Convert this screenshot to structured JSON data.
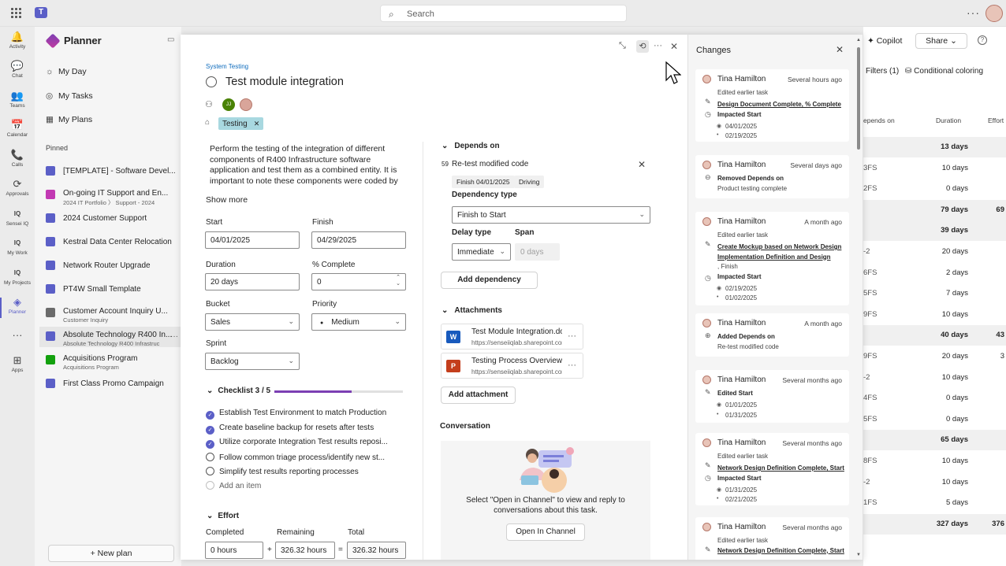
{
  "topbar": {
    "search_placeholder": "Search",
    "more": "···"
  },
  "rail": [
    {
      "icon": "activity-icon",
      "glyph": "🔔",
      "label": "Activity"
    },
    {
      "icon": "chat-icon",
      "glyph": "💬",
      "label": "Chat"
    },
    {
      "icon": "teams-icon",
      "glyph": "👥",
      "label": "Teams"
    },
    {
      "icon": "calendar-icon",
      "glyph": "📅",
      "label": "Calendar"
    },
    {
      "icon": "calls-icon",
      "glyph": "📞",
      "label": "Calls"
    },
    {
      "icon": "approvals-icon",
      "glyph": "⟳",
      "label": "Approvals"
    },
    {
      "icon": "sensei-iq-icon",
      "glyph": "IQ",
      "label": "Sensei IQ"
    },
    {
      "icon": "my-work-icon",
      "glyph": "IQ",
      "label": "My Work"
    },
    {
      "icon": "my-projects-icon",
      "glyph": "IQ",
      "label": "My Projects"
    },
    {
      "icon": "planner-icon",
      "glyph": "◈",
      "label": "Planner"
    },
    {
      "icon": "more-apps-icon",
      "glyph": "···",
      "label": ""
    },
    {
      "icon": "apps-icon",
      "glyph": "⊞",
      "label": "Apps"
    }
  ],
  "leftpane": {
    "title": "Planner",
    "nav": [
      {
        "icon": "sun-icon",
        "glyph": "☼",
        "label": "My Day"
      },
      {
        "icon": "tasks-icon",
        "glyph": "◎",
        "label": "My Tasks"
      },
      {
        "icon": "plans-icon",
        "glyph": "▦",
        "label": "My Plans"
      }
    ],
    "pinned_header": "Pinned",
    "pinned": [
      {
        "name": "[TEMPLATE] - Software Devel...",
        "sub": "",
        "color": "#5b5fc7"
      },
      {
        "name": "On-going IT Support and En...",
        "sub": "2024 IT Portfolio  〉 Support - 2024",
        "color": "#c239b3"
      },
      {
        "name": "2024 Customer Support",
        "sub": "",
        "color": "#5b5fc7"
      },
      {
        "name": "Kestral Data Center Relocation",
        "sub": "",
        "color": "#5b5fc7"
      },
      {
        "name": "Network Router Upgrade",
        "sub": "",
        "color": "#5b5fc7"
      },
      {
        "name": "PT4W Small Template",
        "sub": "",
        "color": "#5b5fc7"
      },
      {
        "name": "Customer Account Inquiry U...",
        "sub": "Customer Inquiry",
        "color": "#6b6b6b"
      },
      {
        "name": "Absolute Technology R400 In...",
        "sub": "Absolute Technology R400 Infrastruc",
        "color": "#5b5fc7"
      },
      {
        "name": "Acquisitions Program",
        "sub": "Acquisitions Program",
        "color": "#13a10e"
      },
      {
        "name": "First Class Promo Campaign",
        "sub": "",
        "color": "#5b5fc7"
      }
    ],
    "new_plan": "New plan"
  },
  "background": {
    "copilot": "Copilot",
    "share": "Share",
    "filters": "Filters (1)",
    "conditional": "Conditional coloring",
    "col_depends": "epends on",
    "col_duration": "Duration",
    "col_effort": "Effort",
    "rows": [
      {
        "a": "",
        "b": "13 days",
        "c": "",
        "bold": true
      },
      {
        "a": "3FS",
        "b": "10 days",
        "c": "",
        "bold": false
      },
      {
        "a": "2FS",
        "b": "0 days",
        "c": "",
        "bold": false
      },
      {
        "a": "",
        "b": "79 days",
        "c": "69",
        "bold": true
      },
      {
        "a": "",
        "b": "39 days",
        "c": "",
        "bold": true
      },
      {
        "a": "-2",
        "b": "20 days",
        "c": "",
        "bold": false
      },
      {
        "a": "6FS",
        "b": "2 days",
        "c": "",
        "bold": false
      },
      {
        "a": "5FS",
        "b": "7 days",
        "c": "",
        "bold": false
      },
      {
        "a": "9FS",
        "b": "10 days",
        "c": "",
        "bold": false
      },
      {
        "a": "",
        "b": "40 days",
        "c": "43",
        "bold": true
      },
      {
        "a": "9FS",
        "b": "20 days",
        "c": "3",
        "bold": false
      },
      {
        "a": "-2",
        "b": "10 days",
        "c": "",
        "bold": false
      },
      {
        "a": "4FS",
        "b": "0 days",
        "c": "",
        "bold": false
      },
      {
        "a": "5FS",
        "b": "0 days",
        "c": "",
        "bold": false
      },
      {
        "a": "",
        "b": "65 days",
        "c": "",
        "bold": true
      },
      {
        "a": "8FS",
        "b": "10 days",
        "c": "",
        "bold": false
      },
      {
        "a": "-2",
        "b": "10 days",
        "c": "",
        "bold": false
      },
      {
        "a": "1FS",
        "b": "5 days",
        "c": "",
        "bold": false
      },
      {
        "a": "",
        "b": "327 days",
        "c": "376",
        "bold": true
      }
    ]
  },
  "task": {
    "breadcrumb": "System Testing",
    "title": "Test module integration",
    "assignees": [
      {
        "initials": "JJ",
        "color": "#498205"
      },
      {
        "initials": "",
        "color": "#d9a59a"
      }
    ],
    "label": "Testing",
    "description": "Perform the testing of the integration of different components of R400 Infrastructure software application and test them as a combined entity. It is important to note these components were coded by different",
    "show_more": "Show more",
    "start_label": "Start",
    "start": "04/01/2025",
    "finish_label": "Finish",
    "finish": "04/29/2025",
    "duration_label": "Duration",
    "duration": "20 days",
    "complete_label": "% Complete",
    "complete": "0",
    "bucket_label": "Bucket",
    "bucket": "Sales",
    "priority_label": "Priority",
    "priority": "Medium",
    "sprint_label": "Sprint",
    "sprint": "Backlog",
    "checklist_label": "Checklist 3 / 5",
    "checklist_progress": 0.6,
    "checklist": [
      {
        "text": "Establish Test Environment to match Production",
        "done": true
      },
      {
        "text": "Create baseline backup for resets after tests",
        "done": true
      },
      {
        "text": "Utilize corporate Integration Test results reposi...",
        "done": true
      },
      {
        "text": "Follow common triage process/identify new st...",
        "done": false
      },
      {
        "text": "Simplify test results reporting processes",
        "done": false
      }
    ],
    "add_item": "Add an item",
    "effort_label": "Effort",
    "completed_label": "Completed",
    "completed": "0 hours",
    "remaining_label": "Remaining",
    "remaining": "326.32 hours",
    "total_label": "Total",
    "total": "326.32 hours",
    "plus": "+",
    "equals": "="
  },
  "depends": {
    "header": "Depends on",
    "item_id": "59",
    "item_name": "Re-test modified code",
    "chip_finish": "Finish 04/01/2025",
    "chip_driving": "Driving",
    "dep_type_label": "Dependency type",
    "dep_type": "Finish to Start",
    "delay_type_label": "Delay type",
    "delay_type": "Immediate",
    "span_label": "Span",
    "span_placeholder": "0 days",
    "add_dependency": "Add dependency"
  },
  "attachments": {
    "header": "Attachments",
    "items": [
      {
        "name": "Test Module Integration.docx",
        "url": "https://senseiiqlab.sharepoint.com",
        "type": "W",
        "color": "#185abd"
      },
      {
        "name": "Testing Process Overview.pptx",
        "url": "https://senseiiqlab.sharepoint.com",
        "type": "P",
        "color": "#c43e1c"
      }
    ],
    "add": "Add attachment"
  },
  "conversation": {
    "header": "Conversation",
    "text": "Select \"Open in Channel\" to view and reply to conversations about this task.",
    "button": "Open In Channel"
  },
  "changes": {
    "title": "Changes",
    "cards": [
      {
        "who": "Tina Hamilton",
        "when": "Several hours ago",
        "lines": [
          {
            "t": "Edited earlier task",
            "s": ""
          },
          {
            "t": "Design Document Complete, % Complete",
            "s": "u"
          },
          {
            "t": "Impacted Start",
            "s": "b"
          },
          {
            "t": "04/01/2025",
            "s": ""
          },
          {
            "t": "02/19/2025",
            "s": ""
          }
        ]
      },
      {
        "who": "Tina Hamilton",
        "when": "Several days ago",
        "lines": [
          {
            "t": "Removed Depends on",
            "s": "b"
          },
          {
            "t": "Product testing complete",
            "s": ""
          }
        ]
      },
      {
        "who": "Tina Hamilton",
        "when": "A month ago",
        "lines": [
          {
            "t": "Edited earlier task",
            "s": ""
          },
          {
            "t": "Create Mockup based on Network Design",
            "s": "u"
          },
          {
            "t": "Implementation Definition and Design",
            "s": "u"
          },
          {
            "t": ", Finish",
            "s": ""
          },
          {
            "t": "Impacted Start",
            "s": "b"
          },
          {
            "t": "02/19/2025",
            "s": ""
          },
          {
            "t": "01/02/2025",
            "s": ""
          }
        ]
      },
      {
        "who": "Tina Hamilton",
        "when": "A month ago",
        "lines": [
          {
            "t": "Added Depends on",
            "s": "b"
          },
          {
            "t": "Re-test modified code",
            "s": ""
          }
        ]
      },
      {
        "who": "Tina Hamilton",
        "when": "Several months ago",
        "lines": [
          {
            "t": "Edited Start",
            "s": "b"
          },
          {
            "t": "01/01/2025",
            "s": ""
          },
          {
            "t": "01/31/2025",
            "s": ""
          }
        ]
      },
      {
        "who": "Tina Hamilton",
        "when": "Several months ago",
        "lines": [
          {
            "t": "Edited earlier task",
            "s": ""
          },
          {
            "t": "Network Design Definition Complete, Start",
            "s": "u"
          },
          {
            "t": "Impacted Start",
            "s": "b"
          },
          {
            "t": "01/31/2025",
            "s": ""
          },
          {
            "t": "02/21/2025",
            "s": ""
          }
        ]
      },
      {
        "who": "Tina Hamilton",
        "when": "Several months ago",
        "lines": [
          {
            "t": "Edited earlier task",
            "s": ""
          },
          {
            "t": "Network Design Definition Complete, Start",
            "s": "u"
          }
        ]
      }
    ]
  }
}
